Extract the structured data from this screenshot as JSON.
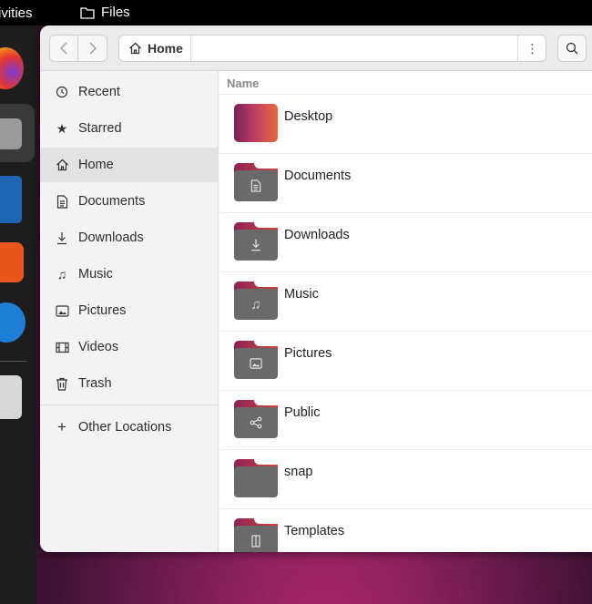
{
  "topbar": {
    "activities": "ivities",
    "app_name": "Files"
  },
  "toolbar": {
    "path": "Home",
    "menu_glyph": "⋮"
  },
  "sidebar": {
    "items": [
      {
        "label": "Recent",
        "icon": "clock-icon"
      },
      {
        "label": "Starred",
        "icon": "star-icon"
      },
      {
        "label": "Home",
        "icon": "home-icon",
        "selected": true
      },
      {
        "label": "Documents",
        "icon": "document-icon"
      },
      {
        "label": "Downloads",
        "icon": "download-icon"
      },
      {
        "label": "Music",
        "icon": "music-icon"
      },
      {
        "label": "Pictures",
        "icon": "picture-icon"
      },
      {
        "label": "Videos",
        "icon": "video-icon"
      },
      {
        "label": "Trash",
        "icon": "trash-icon"
      }
    ],
    "other_locations": "Other Locations"
  },
  "main": {
    "column_header": "Name",
    "files": [
      {
        "name": "Desktop",
        "icon": "desktop-folder-icon"
      },
      {
        "name": "Documents",
        "icon": "documents-folder-icon"
      },
      {
        "name": "Downloads",
        "icon": "downloads-folder-icon"
      },
      {
        "name": "Music",
        "icon": "music-folder-icon"
      },
      {
        "name": "Pictures",
        "icon": "pictures-folder-icon"
      },
      {
        "name": "Public",
        "icon": "public-folder-icon"
      },
      {
        "name": "snap",
        "icon": "folder-icon"
      },
      {
        "name": "Templates",
        "icon": "templates-folder-icon"
      }
    ]
  },
  "colors": {
    "accent_start": "#8e2159",
    "accent_end": "#d1483a",
    "folder_body": "#6a6a6a"
  }
}
